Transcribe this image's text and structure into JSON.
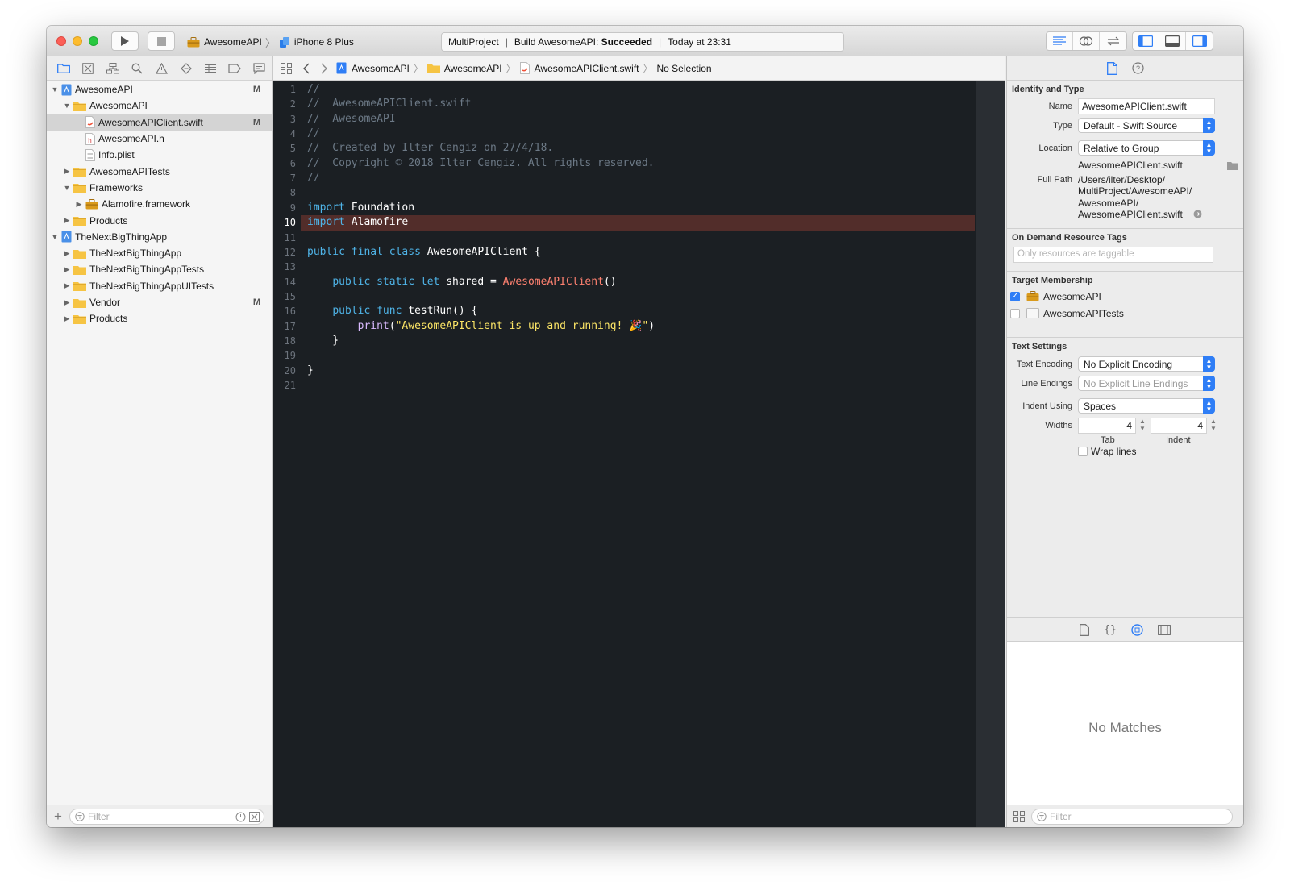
{
  "toolbar": {
    "scheme": "AwesomeAPI",
    "device": "iPhone 8 Plus",
    "activity": {
      "project": "MultiProject",
      "build_prefix": "Build AwesomeAPI:",
      "build_status": "Succeeded",
      "time": "Today at 23:31"
    }
  },
  "navigator": {
    "tree": [
      {
        "label": "AwesomeAPI",
        "icon": "project-icon",
        "status": "M"
      },
      {
        "label": "AwesomeAPI",
        "icon": "folder-icon",
        "status": ""
      },
      {
        "label": "AwesomeAPIClient.swift",
        "icon": "swift-file-icon",
        "status": "M"
      },
      {
        "label": "AwesomeAPI.h",
        "icon": "header-file-icon",
        "status": ""
      },
      {
        "label": "Info.plist",
        "icon": "plist-file-icon",
        "status": ""
      },
      {
        "label": "AwesomeAPITests",
        "icon": "folder-icon",
        "status": ""
      },
      {
        "label": "Frameworks",
        "icon": "folder-icon",
        "status": ""
      },
      {
        "label": "Alamofire.framework",
        "icon": "framework-icon",
        "status": ""
      },
      {
        "label": "Products",
        "icon": "folder-icon",
        "status": ""
      },
      {
        "label": "TheNextBigThingApp",
        "icon": "project-icon",
        "status": ""
      },
      {
        "label": "TheNextBigThingApp",
        "icon": "folder-icon",
        "status": ""
      },
      {
        "label": "TheNextBigThingAppTests",
        "icon": "folder-icon",
        "status": ""
      },
      {
        "label": "TheNextBigThingAppUITests",
        "icon": "folder-icon",
        "status": ""
      },
      {
        "label": "Vendor",
        "icon": "folder-icon",
        "status": "M"
      },
      {
        "label": "Products",
        "icon": "folder-icon",
        "status": ""
      }
    ],
    "filter_placeholder": "Filter"
  },
  "jumpbar": {
    "project": "AwesomeAPI",
    "group": "AwesomeAPI",
    "file": "AwesomeAPIClient.swift",
    "symbol": "No Selection"
  },
  "editor": {
    "current_line": 10,
    "lines": [
      "//",
      "//  AwesomeAPIClient.swift",
      "//  AwesomeAPI",
      "//",
      "//  Created by Ilter Cengiz on 27/4/18.",
      "//  Copyright © 2018 Ilter Cengiz. All rights reserved.",
      "//",
      "",
      "import Foundation",
      "import Alamofire",
      "",
      "public final class AwesomeAPIClient {",
      "",
      "    public static let shared = AwesomeAPIClient()",
      "",
      "    public func testRun() {",
      "        print(\"AwesomeAPIClient is up and running! 🎉\")",
      "    }",
      "",
      "}",
      ""
    ]
  },
  "inspector": {
    "identity": {
      "header": "Identity and Type",
      "name_label": "Name",
      "name_value": "AwesomeAPIClient.swift",
      "type_label": "Type",
      "type_value": "Default - Swift Source",
      "location_label": "Location",
      "location_value": "Relative to Group",
      "location_file": "AwesomeAPIClient.swift",
      "fullpath_label": "Full Path",
      "fullpath_lines": [
        "/Users/ilter/Desktop/",
        "MultiProject/AwesomeAPI/",
        "AwesomeAPI/",
        "AwesomeAPIClient.swift"
      ]
    },
    "odr": {
      "header": "On Demand Resource Tags",
      "placeholder": "Only resources are taggable"
    },
    "target_membership": {
      "header": "Target Membership",
      "targets": [
        {
          "name": "AwesomeAPI",
          "checked": true
        },
        {
          "name": "AwesomeAPITests",
          "checked": false
        }
      ]
    },
    "text_settings": {
      "header": "Text Settings",
      "encoding_label": "Text Encoding",
      "encoding_value": "No Explicit Encoding",
      "line_endings_label": "Line Endings",
      "line_endings_value": "No Explicit Line Endings",
      "indent_using_label": "Indent Using",
      "indent_using_value": "Spaces",
      "widths_label": "Widths",
      "tab_width": "4",
      "indent_width": "4",
      "tab_caption": "Tab",
      "indent_caption": "Indent",
      "wrap_lines_label": "Wrap lines"
    },
    "library": {
      "no_matches": "No Matches",
      "filter_placeholder": "Filter"
    }
  },
  "colors": {
    "editor_bg": "#1b1f23",
    "keyword": "#4fb4e8",
    "type": "#ff8170",
    "string": "#fce566",
    "comment": "#6c7986",
    "current_line_highlight": "#522d2a",
    "accent": "#2f7ef6"
  }
}
